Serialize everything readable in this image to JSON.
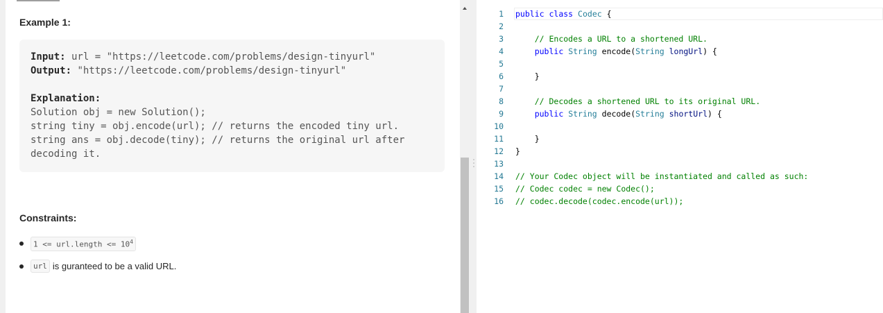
{
  "description": {
    "example_title": "Example 1:",
    "example_lines": [
      {
        "label": "Input:",
        "text": " url = \"https://leetcode.com/problems/design-tinyurl\""
      },
      {
        "label": "Output:",
        "text": " \"https://leetcode.com/problems/design-tinyurl\""
      },
      {
        "label": "Explanation:",
        "text": ""
      },
      {
        "label": "",
        "text": "Solution obj = new Solution();"
      },
      {
        "label": "",
        "text": "string tiny = obj.encode(url); // returns the encoded tiny url."
      },
      {
        "label": "",
        "text": "string ans = obj.decode(tiny); // returns the original url after"
      },
      {
        "label": "",
        "text": "decoding it."
      }
    ],
    "constraints_title": "Constraints:",
    "constraints": [
      {
        "code": "1 <= url.length <= 10",
        "sup": "4",
        "text": ""
      },
      {
        "code": "url",
        "sup": "",
        "text": "is guranteed to be a valid URL."
      }
    ]
  },
  "editor": {
    "lines": [
      {
        "num": "1",
        "tokens": [
          [
            "kw",
            "public"
          ],
          [
            "pl",
            " "
          ],
          [
            "kw",
            "class"
          ],
          [
            "pl",
            " "
          ],
          [
            "ty",
            "Codec"
          ],
          [
            "pl",
            " {"
          ]
        ]
      },
      {
        "num": "2",
        "tokens": []
      },
      {
        "num": "3",
        "tokens": [
          [
            "pl",
            "    "
          ],
          [
            "cm",
            "// Encodes a URL to a shortened URL."
          ]
        ]
      },
      {
        "num": "4",
        "tokens": [
          [
            "pl",
            "    "
          ],
          [
            "kw",
            "public"
          ],
          [
            "pl",
            " "
          ],
          [
            "ty",
            "String"
          ],
          [
            "pl",
            " encode("
          ],
          [
            "ty",
            "String"
          ],
          [
            "pl",
            " "
          ],
          [
            "pa",
            "longUrl"
          ],
          [
            "pl",
            ") {"
          ]
        ]
      },
      {
        "num": "5",
        "tokens": []
      },
      {
        "num": "6",
        "tokens": [
          [
            "pl",
            "    }"
          ]
        ]
      },
      {
        "num": "7",
        "tokens": []
      },
      {
        "num": "8",
        "tokens": [
          [
            "pl",
            "    "
          ],
          [
            "cm",
            "// Decodes a shortened URL to its original URL."
          ]
        ]
      },
      {
        "num": "9",
        "tokens": [
          [
            "pl",
            "    "
          ],
          [
            "kw",
            "public"
          ],
          [
            "pl",
            " "
          ],
          [
            "ty",
            "String"
          ],
          [
            "pl",
            " decode("
          ],
          [
            "ty",
            "String"
          ],
          [
            "pl",
            " "
          ],
          [
            "pa",
            "shortUrl"
          ],
          [
            "pl",
            ") {"
          ]
        ]
      },
      {
        "num": "10",
        "tokens": []
      },
      {
        "num": "11",
        "tokens": [
          [
            "pl",
            "    }"
          ]
        ]
      },
      {
        "num": "12",
        "tokens": [
          [
            "pl",
            "}"
          ]
        ]
      },
      {
        "num": "13",
        "tokens": []
      },
      {
        "num": "14",
        "tokens": [
          [
            "cm",
            "// Your Codec object will be instantiated and called as such:"
          ]
        ]
      },
      {
        "num": "15",
        "tokens": [
          [
            "cm",
            "// Codec codec = new Codec();"
          ]
        ]
      },
      {
        "num": "16",
        "tokens": [
          [
            "cm",
            "// codec.decode(codec.encode(url));"
          ]
        ]
      }
    ]
  }
}
